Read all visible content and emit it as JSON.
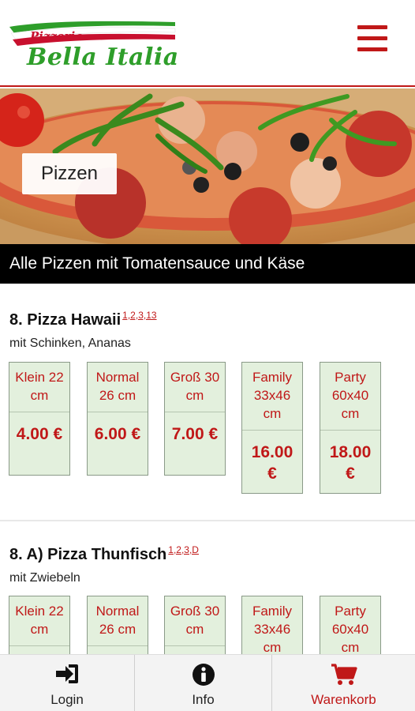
{
  "header": {
    "logo_top": "Pizzeria",
    "logo_main": "Bella Italia",
    "menu_icon": "hamburger-menu-icon"
  },
  "hero": {
    "category_label": "Pizzen"
  },
  "subheader": {
    "text": "Alle Pizzen mit Tomatensauce und Käse"
  },
  "products": [
    {
      "title": "8. Pizza Hawaii",
      "footnotes": "1,2,3,13",
      "description": "mit Schinken, Ananas",
      "sizes": [
        {
          "label": "Klein 22 cm",
          "price": "4.00 €"
        },
        {
          "label": "Normal 26 cm",
          "price": "6.00 €"
        },
        {
          "label": "Groß 30 cm",
          "price": "7.00 €"
        },
        {
          "label": "Family 33x46 cm",
          "price": "16.00 €"
        },
        {
          "label": "Party 60x40 cm",
          "price": "18.00 €"
        }
      ]
    },
    {
      "title": "8. A) Pizza Thunfisch",
      "footnotes": "1,2,3,D",
      "description": "mit Zwiebeln",
      "sizes": [
        {
          "label": "Klein 22 cm"
        },
        {
          "label": "Normal 26 cm"
        },
        {
          "label": "Groß 30 cm"
        },
        {
          "label": "Family 33x46 cm"
        },
        {
          "label": "Party 60x40 cm"
        }
      ]
    }
  ],
  "bottom_nav": {
    "items": [
      {
        "label": "Login",
        "icon": "login-icon"
      },
      {
        "label": "Info",
        "icon": "info-icon"
      },
      {
        "label": "Warenkorb",
        "icon": "cart-icon"
      }
    ]
  },
  "colors": {
    "accent_red": "#c01818",
    "logo_green": "#2e9e2a",
    "size_box_bg": "#e3f0dd"
  }
}
